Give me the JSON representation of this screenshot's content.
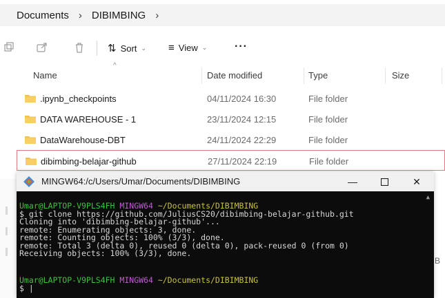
{
  "breadcrumb": {
    "items": [
      "Documents",
      "DIBIMBING"
    ]
  },
  "toolbar": {
    "sort_label": "Sort",
    "view_label": "View",
    "more_label": "···",
    "icons": [
      "copy-icon",
      "share-icon",
      "delete-icon",
      "sort-icon",
      "view-icon"
    ]
  },
  "file_list": {
    "headers": {
      "name": "Name",
      "date": "Date modified",
      "type": "Type",
      "size": "Size"
    },
    "rows": [
      {
        "name": ".ipynb_checkpoints",
        "date": "04/11/2024 16:30",
        "type": "File folder"
      },
      {
        "name": "DATA WAREHOUSE - 1",
        "date": "23/11/2024 12:15",
        "type": "File folder"
      },
      {
        "name": "DataWarehouse-DBT",
        "date": "24/11/2024 22:29",
        "type": "File folder"
      },
      {
        "name": "dibimbing-belajar-github",
        "date": "27/11/2024 22:19",
        "type": "File folder"
      }
    ],
    "folder_color": "#f2c14e",
    "selected_border": "#e07a7a"
  },
  "terminal": {
    "title": "MINGW64:/c/Users/Umar/Documents/DIBIMBING",
    "prompt_user": "Umar@LAPTOP-V9PLS4FH",
    "prompt_env": "MINGW64",
    "prompt_path": "~/Documents/DIBIMBING",
    "command_line": "$ git clone https://github.com/JuliusCS20/dibimbing-belajar-github.git",
    "output": [
      "Cloning into 'dibimbing-belajar-github'...",
      "remote: Enumerating objects: 3, done.",
      "remote: Counting objects: 100% (3/3), done.",
      "remote: Total 3 (delta 0), reused 0 (delta 0), pack-reused 0 (from 0)",
      "Receiving objects: 100% (3/3), done."
    ],
    "prompt2_user": "Umar@LAPTOP-V9PLS4FH",
    "prompt2_env": "MINGW64",
    "prompt2_path": "~/Documents/DIBIMBING",
    "cursor_line": "$ |",
    "colors": {
      "user": "#3fc03f",
      "env": "#c35ad6",
      "path": "#c8c33a",
      "background": "#0c0c0c"
    }
  },
  "background_peek": "B"
}
